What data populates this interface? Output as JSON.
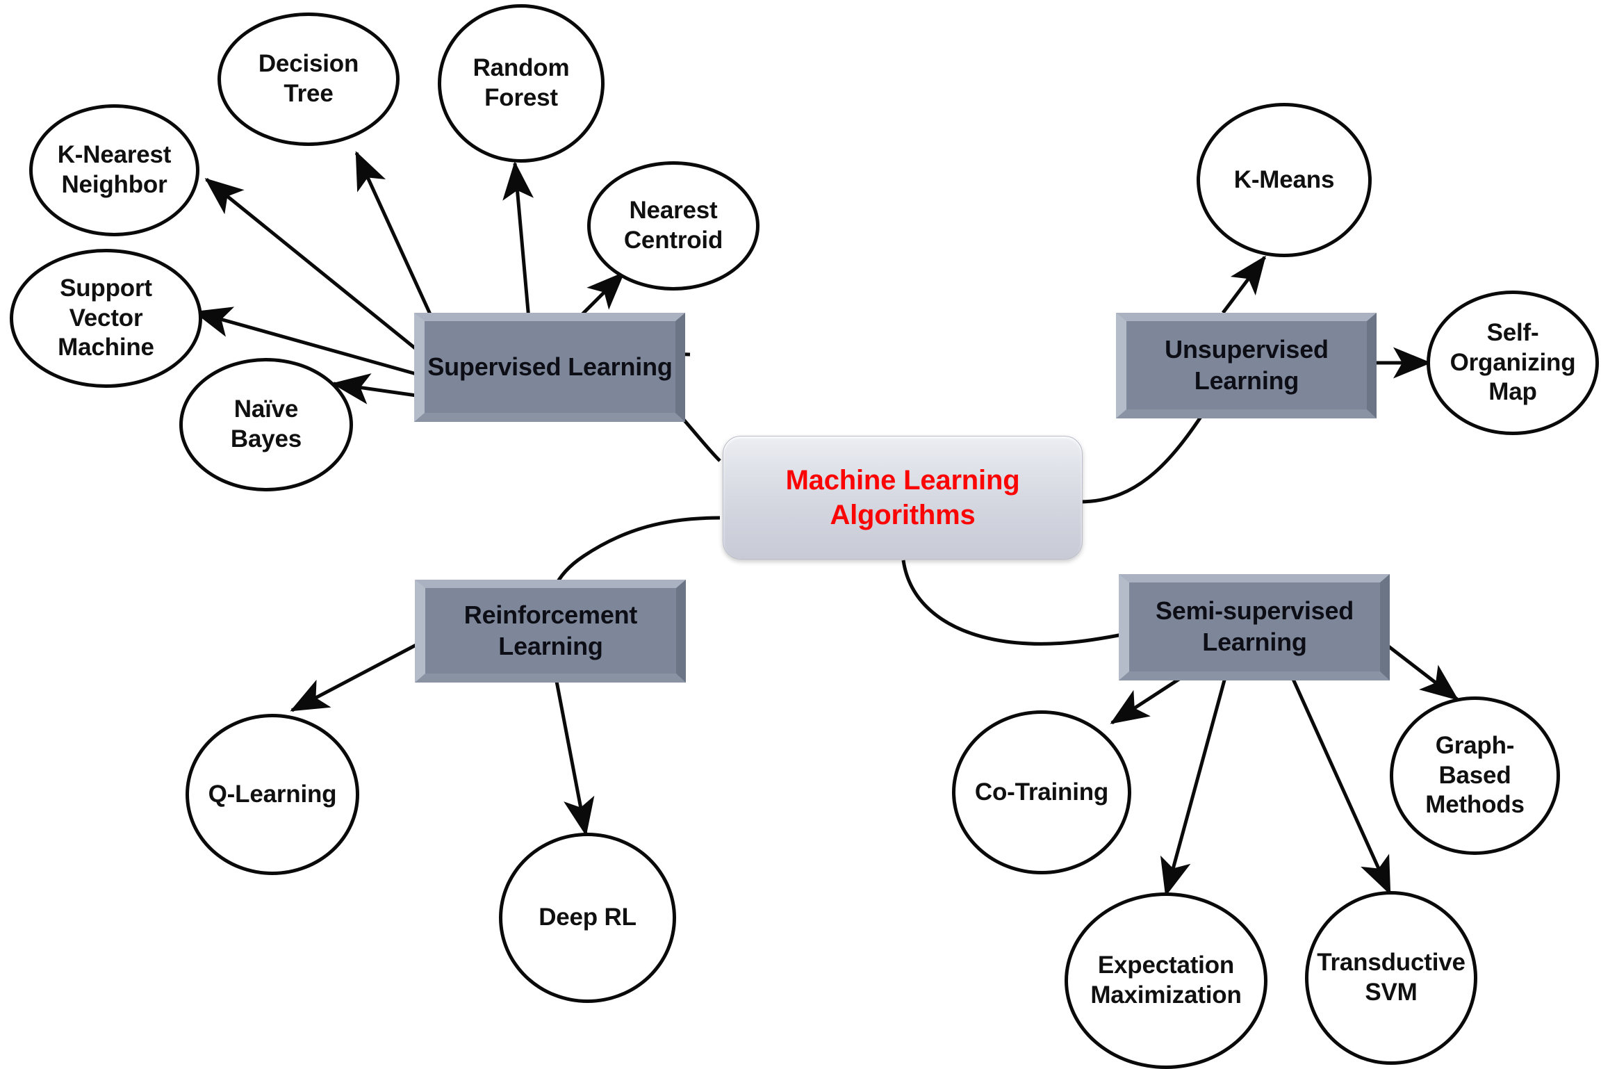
{
  "diagram": {
    "title": "Machine Learning Algorithms",
    "root": {
      "label": "Machine Learning\nAlgorithms",
      "line1": "Machine Learning",
      "line2": "Algorithms",
      "text_color": "#fb0404",
      "fill_color": "#d4d6de"
    },
    "category_fill": "#7d8799",
    "category_bevel_light": "#b4bcca",
    "category_bevel_dark": "#6b7586",
    "leaf_fill": "#ffffff",
    "leaf_stroke": "#0a0a0a",
    "edge_color": "#0a0a0a",
    "categories": [
      {
        "id": "supervised",
        "line1": "Supervised",
        "line2": "Learning",
        "children": [
          {
            "id": "knn",
            "line1": "K-Nearest",
            "line2": "Neighbor"
          },
          {
            "id": "decision-tree",
            "line1": "Decision",
            "line2": "Tree"
          },
          {
            "id": "random-forest",
            "line1": "Random",
            "line2": "Forest"
          },
          {
            "id": "nearest-centroid",
            "line1": "Nearest",
            "line2": "Centroid"
          },
          {
            "id": "svm",
            "line1": "Support",
            "line2": "Vector",
            "line3": "Machine"
          },
          {
            "id": "naive-bayes",
            "line1": "Naïve",
            "line2": "Bayes"
          }
        ]
      },
      {
        "id": "unsupervised",
        "line1": "Unsupervised",
        "line2": "Learning",
        "children": [
          {
            "id": "k-means",
            "line1": "K-Means"
          },
          {
            "id": "som",
            "line1": "Self-",
            "line2": "Organizing",
            "line3": "Map"
          }
        ]
      },
      {
        "id": "reinforcement",
        "line1": "Reinforcement",
        "line2": "Learning",
        "children": [
          {
            "id": "q-learning",
            "line1": "Q-Learning"
          },
          {
            "id": "deep-rl",
            "line1": "Deep RL"
          }
        ]
      },
      {
        "id": "semi-supervised",
        "line1": "Semi-supervised",
        "line2": "Learning",
        "children": [
          {
            "id": "co-training",
            "line1": "Co-Training"
          },
          {
            "id": "expectation-maximization",
            "line1": "Expectation",
            "line2": "Maximization"
          },
          {
            "id": "transductive-svm",
            "line1": "Transductive",
            "line2": "SVM"
          },
          {
            "id": "graph-based-methods",
            "line1": "Graph-",
            "line2": "Based",
            "line3": "Methods"
          }
        ]
      }
    ]
  }
}
